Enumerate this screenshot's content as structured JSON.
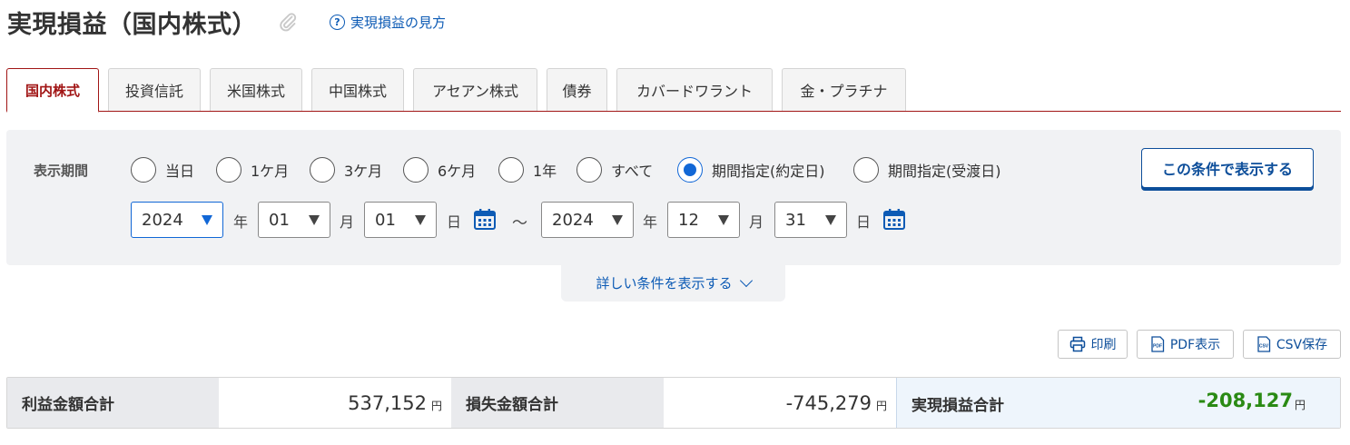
{
  "header": {
    "title": "実現損益（国内株式）",
    "help_link": "実現損益の見方",
    "help_icon_glyph": "?"
  },
  "tabs": [
    {
      "label": "国内株式",
      "active": true
    },
    {
      "label": "投資信託",
      "active": false
    },
    {
      "label": "米国株式",
      "active": false
    },
    {
      "label": "中国株式",
      "active": false
    },
    {
      "label": "アセアン株式",
      "active": false
    },
    {
      "label": "債券",
      "active": false
    },
    {
      "label": "カバードワラント",
      "active": false
    },
    {
      "label": "金・プラチナ",
      "active": false
    }
  ],
  "filter": {
    "period_label": "表示期間",
    "options": [
      {
        "label": "当日",
        "selected": false
      },
      {
        "label": "1ケ月",
        "selected": false
      },
      {
        "label": "3ケ月",
        "selected": false
      },
      {
        "label": "6ケ月",
        "selected": false
      },
      {
        "label": "1年",
        "selected": false
      },
      {
        "label": "すべて",
        "selected": false
      },
      {
        "label": "期間指定(約定日)",
        "selected": true
      },
      {
        "label": "期間指定(受渡日)",
        "selected": false
      }
    ],
    "submit_label": "この条件で表示する",
    "from": {
      "year": "2024",
      "month": "01",
      "day": "01"
    },
    "to": {
      "year": "2024",
      "month": "12",
      "day": "31"
    },
    "unit_year": "年",
    "unit_month": "月",
    "unit_day": "日",
    "range_separator": "～",
    "detail_toggle": "詳しい条件を表示する"
  },
  "toolbar": {
    "print": "印刷",
    "pdf": "PDF表示",
    "csv": "CSV保存",
    "pdf_icon_text": "PDF",
    "csv_icon_text": "CSV"
  },
  "summary": {
    "profit_label": "利益金額合計",
    "profit_value": "537,152",
    "loss_label": "損失金額合計",
    "loss_value": "-745,279",
    "net_label": "実現損益合計",
    "net_value": "-208,127",
    "currency": "円"
  },
  "colors": {
    "accent_red": "#a11515",
    "link_blue": "#0d5bb5",
    "radio_blue": "#1167d6",
    "net_green": "#2a8a14"
  }
}
